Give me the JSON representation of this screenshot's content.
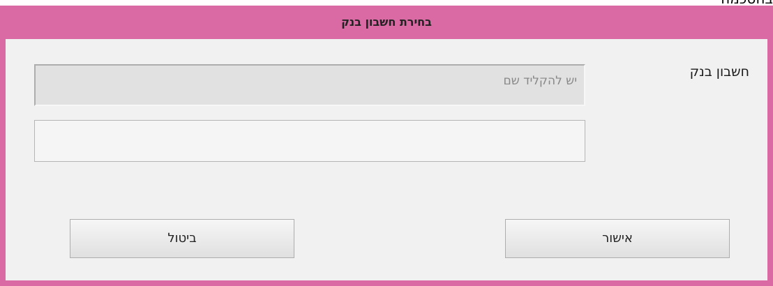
{
  "top_clipped_text": "בהסכמה",
  "window": {
    "title": "בחירת חשבון בנק"
  },
  "form": {
    "bank_account_label": "חשבון בנק",
    "name_field": {
      "placeholder": "יש להקליד שם",
      "value": ""
    },
    "second_field": {
      "value": ""
    }
  },
  "buttons": {
    "ok_label": "אישור",
    "cancel_label": "ביטול"
  },
  "colors": {
    "window_frame": "#d96aa3",
    "client_background": "#f1f1f1"
  }
}
